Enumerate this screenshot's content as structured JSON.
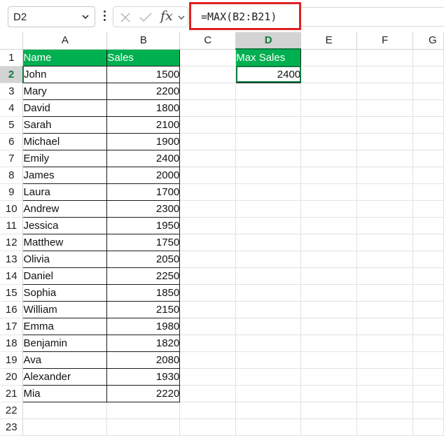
{
  "name_box": {
    "value": "D2"
  },
  "formula_bar": {
    "formula": "=MAX(B2:B21)"
  },
  "columns": [
    "A",
    "B",
    "C",
    "D",
    "E",
    "F",
    "G"
  ],
  "rows": [
    "1",
    "2",
    "3",
    "4",
    "5",
    "6",
    "7",
    "8",
    "9",
    "10",
    "11",
    "12",
    "13",
    "14",
    "15",
    "16",
    "17",
    "18",
    "19",
    "20",
    "21",
    "22",
    "23"
  ],
  "table": {
    "headers": [
      "Name",
      "Sales"
    ],
    "data": [
      [
        "John",
        "1500"
      ],
      [
        "Mary",
        "2200"
      ],
      [
        "David",
        "1800"
      ],
      [
        "Sarah",
        "2100"
      ],
      [
        "Michael",
        "1900"
      ],
      [
        "Emily",
        "2400"
      ],
      [
        "James",
        "2000"
      ],
      [
        "Laura",
        "1700"
      ],
      [
        "Andrew",
        "2300"
      ],
      [
        "Jessica",
        "1950"
      ],
      [
        "Matthew",
        "1750"
      ],
      [
        "Olivia",
        "2050"
      ],
      [
        "Daniel",
        "2250"
      ],
      [
        "Sophia",
        "1850"
      ],
      [
        "William",
        "2150"
      ],
      [
        "Emma",
        "1980"
      ],
      [
        "Benjamin",
        "1820"
      ],
      [
        "Ava",
        "2080"
      ],
      [
        "Alexander",
        "1930"
      ],
      [
        "Mia",
        "2220"
      ]
    ]
  },
  "result": {
    "label": "Max Sales",
    "value": "2400"
  },
  "colors": {
    "header_fill": "#00b050",
    "highlight_border": "#e02020",
    "selection": "#107c41"
  },
  "icons": [
    "chevron-down-icon",
    "more-options-icon",
    "cancel-icon",
    "enter-icon",
    "insert-function-icon"
  ]
}
